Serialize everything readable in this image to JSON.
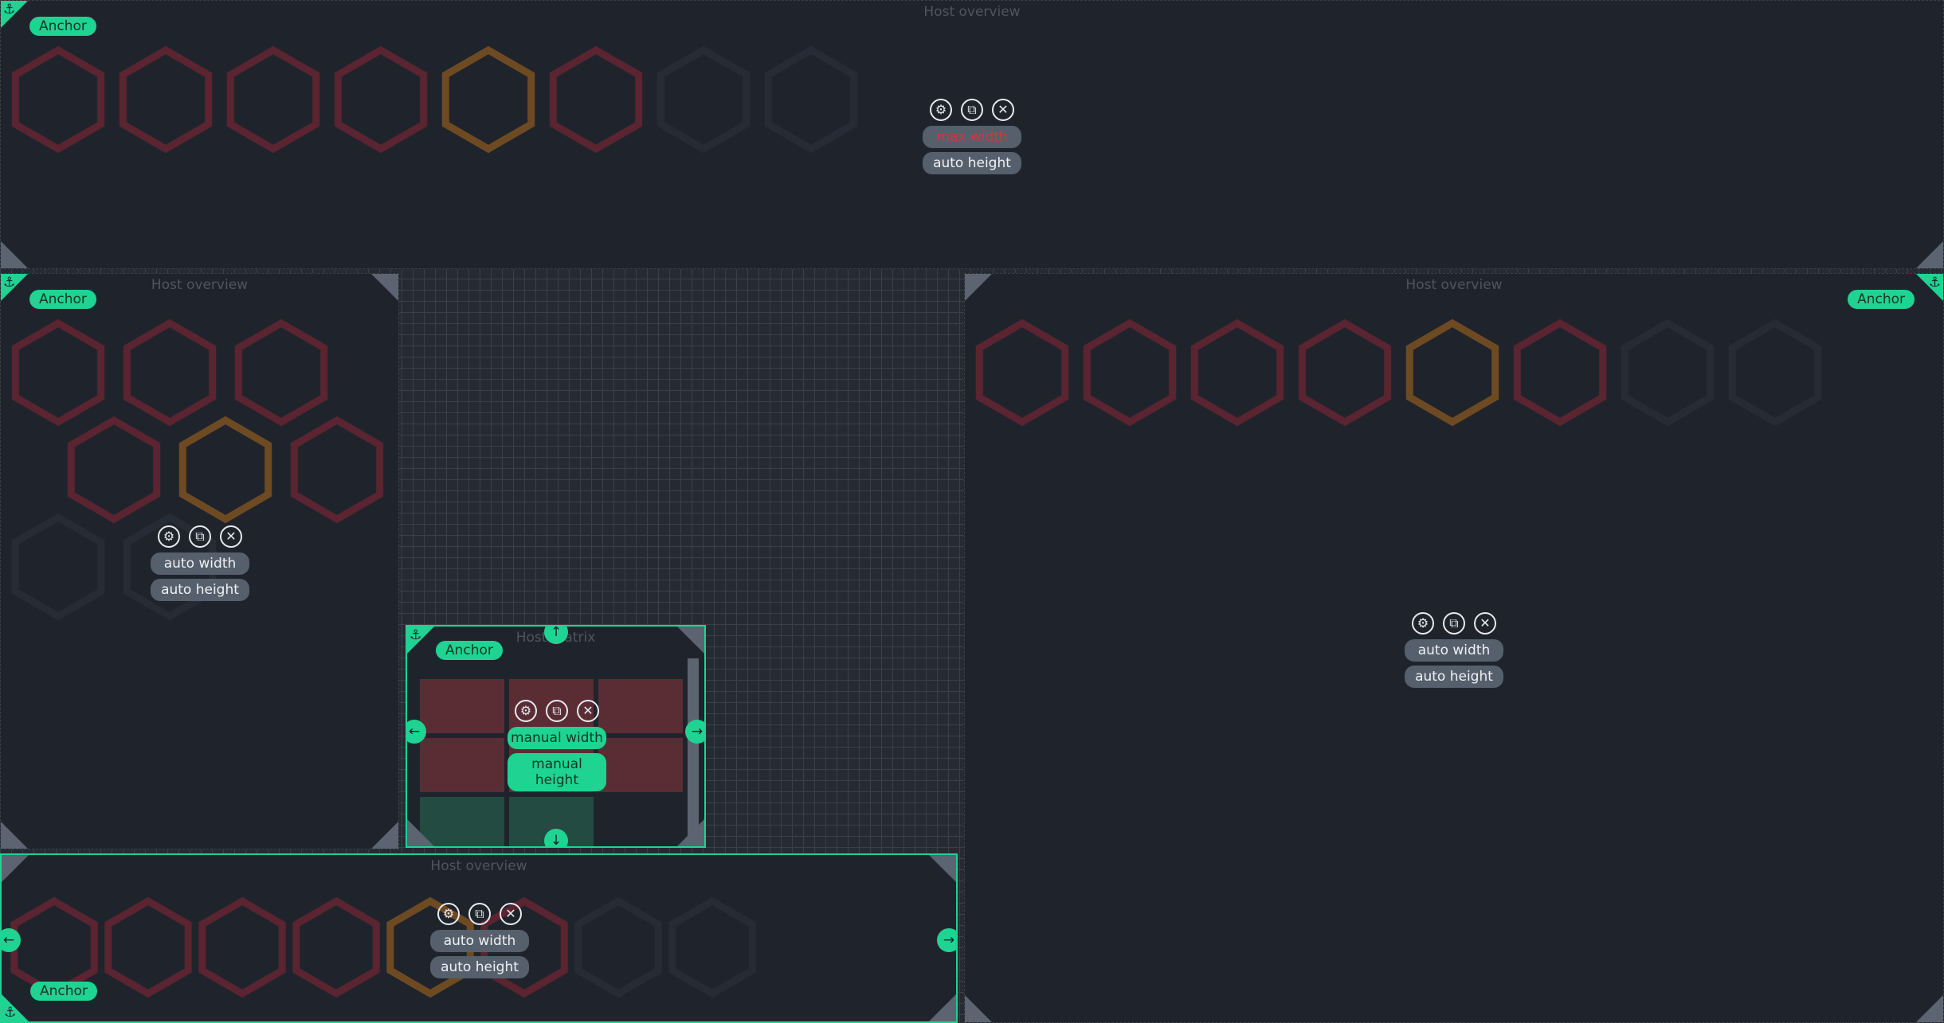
{
  "overview_title": "Host overview",
  "matrix_title": "Host matrix",
  "anchor_label": "Anchor",
  "labels": {
    "max_width": "max width",
    "auto_width": "auto width",
    "auto_height": "auto height",
    "manual_width": "manual width",
    "manual_height": "manual height"
  },
  "icons": {
    "settings": "⚙",
    "duplicate": "⧉",
    "close": "✕",
    "anchor": "⚓",
    "arrow_up": "↑",
    "arrow_down": "↓",
    "arrow_left": "←",
    "arrow_right": "→"
  },
  "colors": {
    "accent": "#1fd392",
    "hex_critical": "#5a2430",
    "hex_warning": "#6e4a22",
    "hex_ok": "#262c35",
    "matrix_critical": "#5a2d35",
    "matrix_ok": "#234b42"
  },
  "host_status_sequence": [
    "critical",
    "critical",
    "critical",
    "critical",
    "warning",
    "critical",
    "ok",
    "ok"
  ],
  "matrix_status_sequence": [
    "critical",
    "critical",
    "critical",
    "critical",
    "critical",
    "critical",
    "ok",
    "ok"
  ]
}
